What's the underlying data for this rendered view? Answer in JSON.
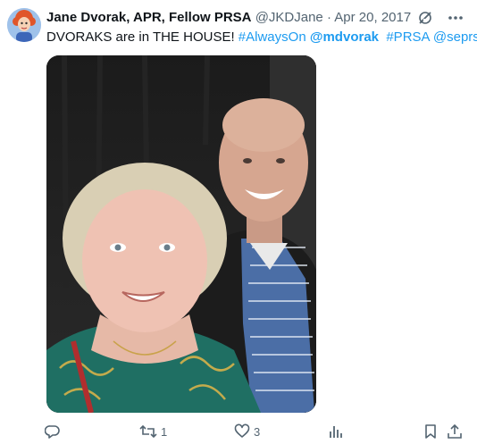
{
  "tweet": {
    "author_name": "Jane Dvorak, APR, Fellow PRSA",
    "handle": "@JKDJane",
    "separator": "·",
    "date": "Apr 20, 2017",
    "text_parts": [
      {
        "text": "DVORAKS are in THE HOUSE! ",
        "type": "plain"
      },
      {
        "text": "#AlwaysOn",
        "type": "link"
      },
      {
        "text": " ",
        "type": "plain"
      },
      {
        "text": "@mdvorak",
        "type": "link"
      },
      {
        "text": "  ",
        "type": "plain"
      },
      {
        "text": "#PRSA",
        "type": "link"
      },
      {
        "text": " ",
        "type": "plain"
      },
      {
        "text": "@seprsa",
        "type": "link"
      }
    ],
    "top_icons": [
      "grok-icon",
      "more-icon"
    ],
    "media": {
      "kind": "photo"
    }
  },
  "actions": {
    "reply": {
      "icon": "reply-icon",
      "count": ""
    },
    "retweet": {
      "icon": "retweet-icon",
      "count": "1"
    },
    "like": {
      "icon": "heart-icon",
      "count": "3"
    },
    "views": {
      "icon": "views-icon",
      "count": ""
    },
    "bookmark": {
      "icon": "bookmark-icon"
    },
    "share": {
      "icon": "share-icon"
    }
  },
  "colors": {
    "link": "#1d9bf0",
    "secondary_text": "#536471",
    "primary_text": "#0f1419"
  }
}
